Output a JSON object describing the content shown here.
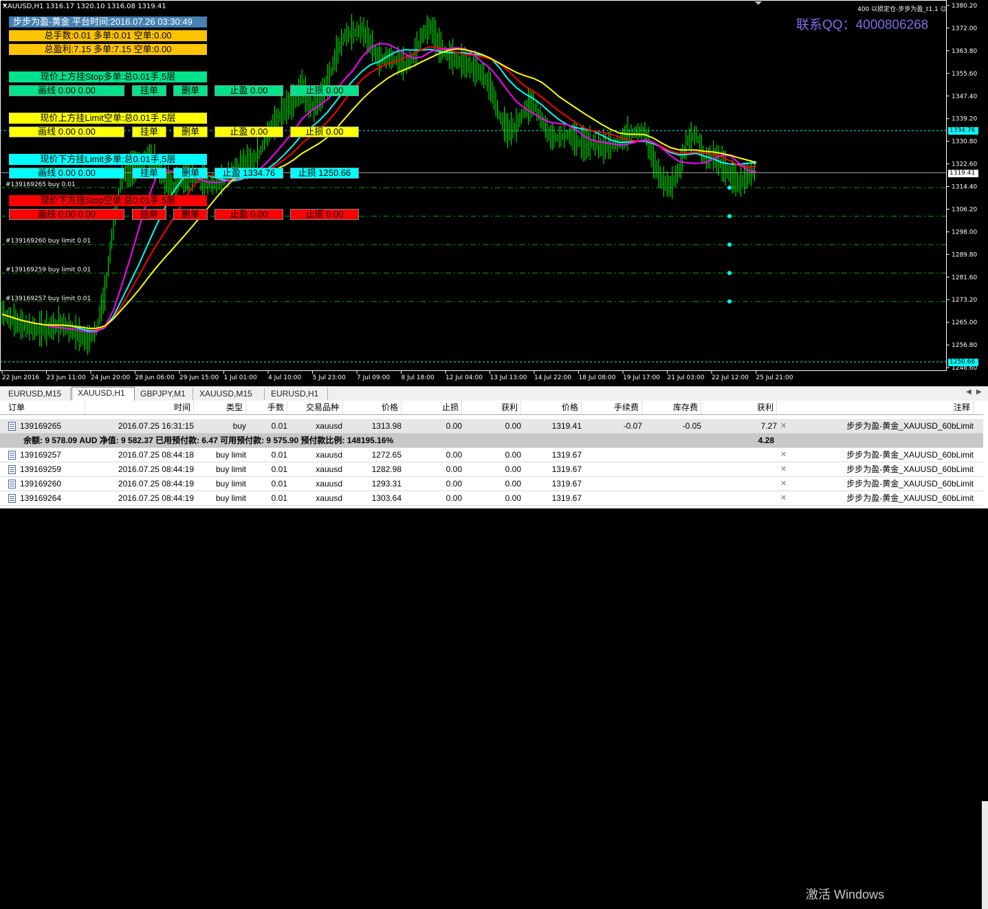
{
  "chart": {
    "symbol_bar": "XAUUSD,H1  1316.17 1320.10 1316.08 1319.41",
    "ea_name": "400 以损定仓-步步为盈_t1.1 ☺",
    "qq": "联系QQ：4000806268",
    "y_ticks": [
      "1380.20",
      "1372.00",
      "1363.80",
      "1355.60",
      "1347.40",
      "1339.20",
      "1330.80",
      "1322.60",
      "1314.40",
      "1306.20",
      "1298.00",
      "1289.80",
      "1281.60",
      "1273.20",
      "1265.00",
      "1256.80",
      "1248.60"
    ],
    "x_ticks": [
      "22 Jun 2016",
      "23 Jun 11:00",
      "24 Jun 20:00",
      "28 Jun 06:00",
      "29 Jun 15:00",
      "1 Jul 01:00",
      "4 Jul 10:00",
      "5 Jul 23:00",
      "7 Jul 09:00",
      "8 Jul 18:00",
      "12 Jul 04:00",
      "13 Jul 13:00",
      "14 Jul 22:00",
      "18 Jul 08:00",
      "19 Jul 17:00",
      "21 Jul 03:00",
      "22 Jul 12:00",
      "25 Jul 21:00"
    ],
    "current_price": "1319.41",
    "line_price_1": "1334.76",
    "line_price_2": "1250.66",
    "order_labels": [
      "#139169265 buy 0.01",
      "#139169260 buy limit 0.01",
      "#139169259 buy limit 0.01",
      "#139169257 buy limit 0.01"
    ],
    "colors": {
      "candles": "#00ff00",
      "ma_fast": "#ff00ff",
      "ma_mid": "#ff0000",
      "ma_slow": "#ffff00",
      "price_line": "#00ffff",
      "bg": "#000000"
    },
    "series_close": [
      1268,
      1266,
      1264,
      1263,
      1262,
      1262,
      1263,
      1264,
      1262,
      1260,
      1258,
      1262,
      1275,
      1300,
      1318,
      1320,
      1322,
      1325,
      1322,
      1316,
      1314,
      1316,
      1318,
      1317,
      1315,
      1315,
      1317,
      1320,
      1322,
      1323,
      1326,
      1333,
      1338,
      1342,
      1345,
      1350,
      1343,
      1345,
      1352,
      1362,
      1369,
      1370,
      1371,
      1366,
      1360,
      1361,
      1360,
      1358,
      1361,
      1369,
      1372,
      1365,
      1362,
      1360,
      1359,
      1357,
      1355,
      1350,
      1340,
      1334,
      1336,
      1342,
      1344,
      1338,
      1332,
      1332,
      1333,
      1331,
      1329,
      1330,
      1328,
      1329,
      1330,
      1333,
      1334,
      1334,
      1323,
      1316,
      1314,
      1320,
      1331,
      1333,
      1324,
      1325,
      1322,
      1318,
      1315,
      1318,
      1320
    ]
  },
  "panel": {
    "title": "步步为盈-黄金 平台时间:2016.07.26 03:30:49",
    "total_lots": "总手数:0.01 多单:0.01 空单:0.00",
    "total_profit": "总盈利:7.15 多单:7.15 空单:0.00",
    "groups": [
      {
        "header": "现价上方挂Stop多单:总0.01手,5层",
        "line": "画线 0.00 0.00",
        "place": "挂单",
        "delete": "删单",
        "tp": "止盈 0.00",
        "sl": "止损 0.00",
        "color": "#00e38a"
      },
      {
        "header": "现价上方挂Limit空单:总0.01手,5层",
        "line": "画线 0.00 0.00",
        "place": "挂单",
        "delete": "删单",
        "tp": "止盈 0.00",
        "sl": "止损 0.00",
        "color": "#ffff00"
      },
      {
        "header": "现价下方挂Limit多单:总0.01手,5层",
        "line": "画线 0.00 0.00",
        "place": "挂单",
        "delete": "删单",
        "tp": "止盈 1334.76",
        "sl": "止损 1250.66",
        "color": "#00ffff"
      },
      {
        "header": "现价下方挂Stop空单:总0.01手,5层",
        "line": "画线 0.00 0.00",
        "place": "挂单",
        "delete": "删单",
        "tp": "止盈 0.00",
        "sl": "止损 0.00",
        "color": "#ff0000"
      }
    ]
  },
  "tabs": [
    "EURUSD,M15",
    "XAUUSD,H1",
    "GBPJPY,M1",
    "XAUUSD,M15",
    "EURUSD,H1"
  ],
  "active_tab": "XAUUSD,H1",
  "table": {
    "headers": [
      "订单",
      "时间",
      "类型",
      "手数",
      "交易品种",
      "价格",
      "止损",
      "获利",
      "价格",
      "手续费",
      "库存费",
      "获利",
      "注释"
    ],
    "rows": [
      [
        "139169265",
        "2016.07.25 16:31:15",
        "buy",
        "0.01",
        "xauusd",
        "1313.98",
        "0.00",
        "0.00",
        "1319.41",
        "-0.07",
        "-0.05",
        "7.27",
        "步步为盈-黄金_XAUUSD_60bLimit"
      ],
      [
        "139169257",
        "2016.07.25 08:44:18",
        "buy limit",
        "0.01",
        "xauusd",
        "1272.65",
        "0.00",
        "0.00",
        "1319.67",
        "",
        "",
        "",
        "步步为盈-黄金_XAUUSD_60bLimit"
      ],
      [
        "139169259",
        "2016.07.25 08:44:19",
        "buy limit",
        "0.01",
        "xauusd",
        "1282.98",
        "0.00",
        "0.00",
        "1319.67",
        "",
        "",
        "",
        "步步为盈-黄金_XAUUSD_60bLimit"
      ],
      [
        "139169260",
        "2016.07.25 08:44:19",
        "buy limit",
        "0.01",
        "xauusd",
        "1293.31",
        "0.00",
        "0.00",
        "1319.67",
        "",
        "",
        "",
        "步步为盈-黄金_XAUUSD_60bLimit"
      ],
      [
        "139169264",
        "2016.07.25 08:44:19",
        "buy limit",
        "0.01",
        "xauusd",
        "1303.64",
        "0.00",
        "0.00",
        "1319.67",
        "",
        "",
        "",
        "步步为盈-黄金_XAUUSD_60bLimit"
      ]
    ],
    "balance_line": "余额: 9 578.09 AUD  净值: 9 582.37  已用预付款: 6.47  可用预付款: 9 575.90  预付款比例: 148195.16%",
    "balance_profit": "4.28"
  },
  "watermark": "激活 Windows"
}
